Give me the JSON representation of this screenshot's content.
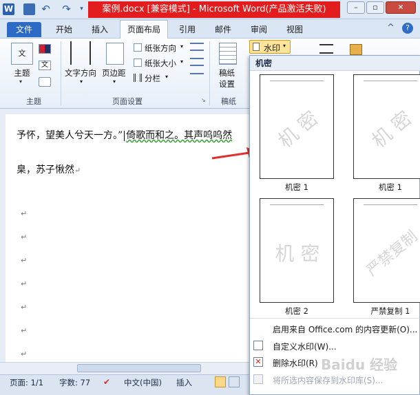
{
  "window": {
    "title": "案例.docx [兼容模式] - Microsoft Word(产品激活失败)",
    "controls": {
      "minimize": "–",
      "restore": "▫",
      "close": "✕"
    }
  },
  "tabs": [
    "文件",
    "开始",
    "插入",
    "页面布局",
    "引用",
    "邮件",
    "审阅",
    "视图"
  ],
  "active_tab": "页面布局",
  "ribbon": {
    "theme_group": {
      "label": "主题",
      "theme_button": "主题"
    },
    "page_setup_group": {
      "label": "页面设置",
      "text_direction": "文字方向",
      "margins": "页边距",
      "orientation": "纸张方向",
      "size": "纸张大小",
      "columns": "分栏"
    },
    "manuscript_group": {
      "label": "稿纸",
      "button": "稿纸设置"
    },
    "watermark_button": "水印"
  },
  "document": {
    "line1_before": "予怀，望美人兮天一方。”",
    "line1_after": "倚歌而和之。其声呜呜然",
    "line2": "臬，苏子愀然",
    "para_mark": "↵"
  },
  "watermark_panel": {
    "header": "机密",
    "thumbnails": [
      {
        "label": "机密 1",
        "text": "机 密"
      },
      {
        "label": "机密 1",
        "text": "机 密"
      },
      {
        "label": "机密 2",
        "text": "机 密"
      },
      {
        "label": "严禁复制 1",
        "text": "严禁复制"
      }
    ],
    "menu": [
      {
        "label": "启用来自 Office.com 的内容更新(O)...",
        "icon": "blank"
      },
      {
        "label": "自定义水印(W)...",
        "icon": "custom-watermark-icon"
      },
      {
        "label": "删除水印(R)",
        "icon": "remove-watermark-icon"
      },
      {
        "label": "将所选内容保存到水印库(S)...",
        "icon": "save-watermark-icon",
        "disabled": true
      }
    ]
  },
  "status_bar": {
    "page": "页面: 1/1",
    "words": "字数: 77",
    "language": "中文(中国)",
    "mode": "插入"
  },
  "watermark_overlay": "Baidu 经验"
}
